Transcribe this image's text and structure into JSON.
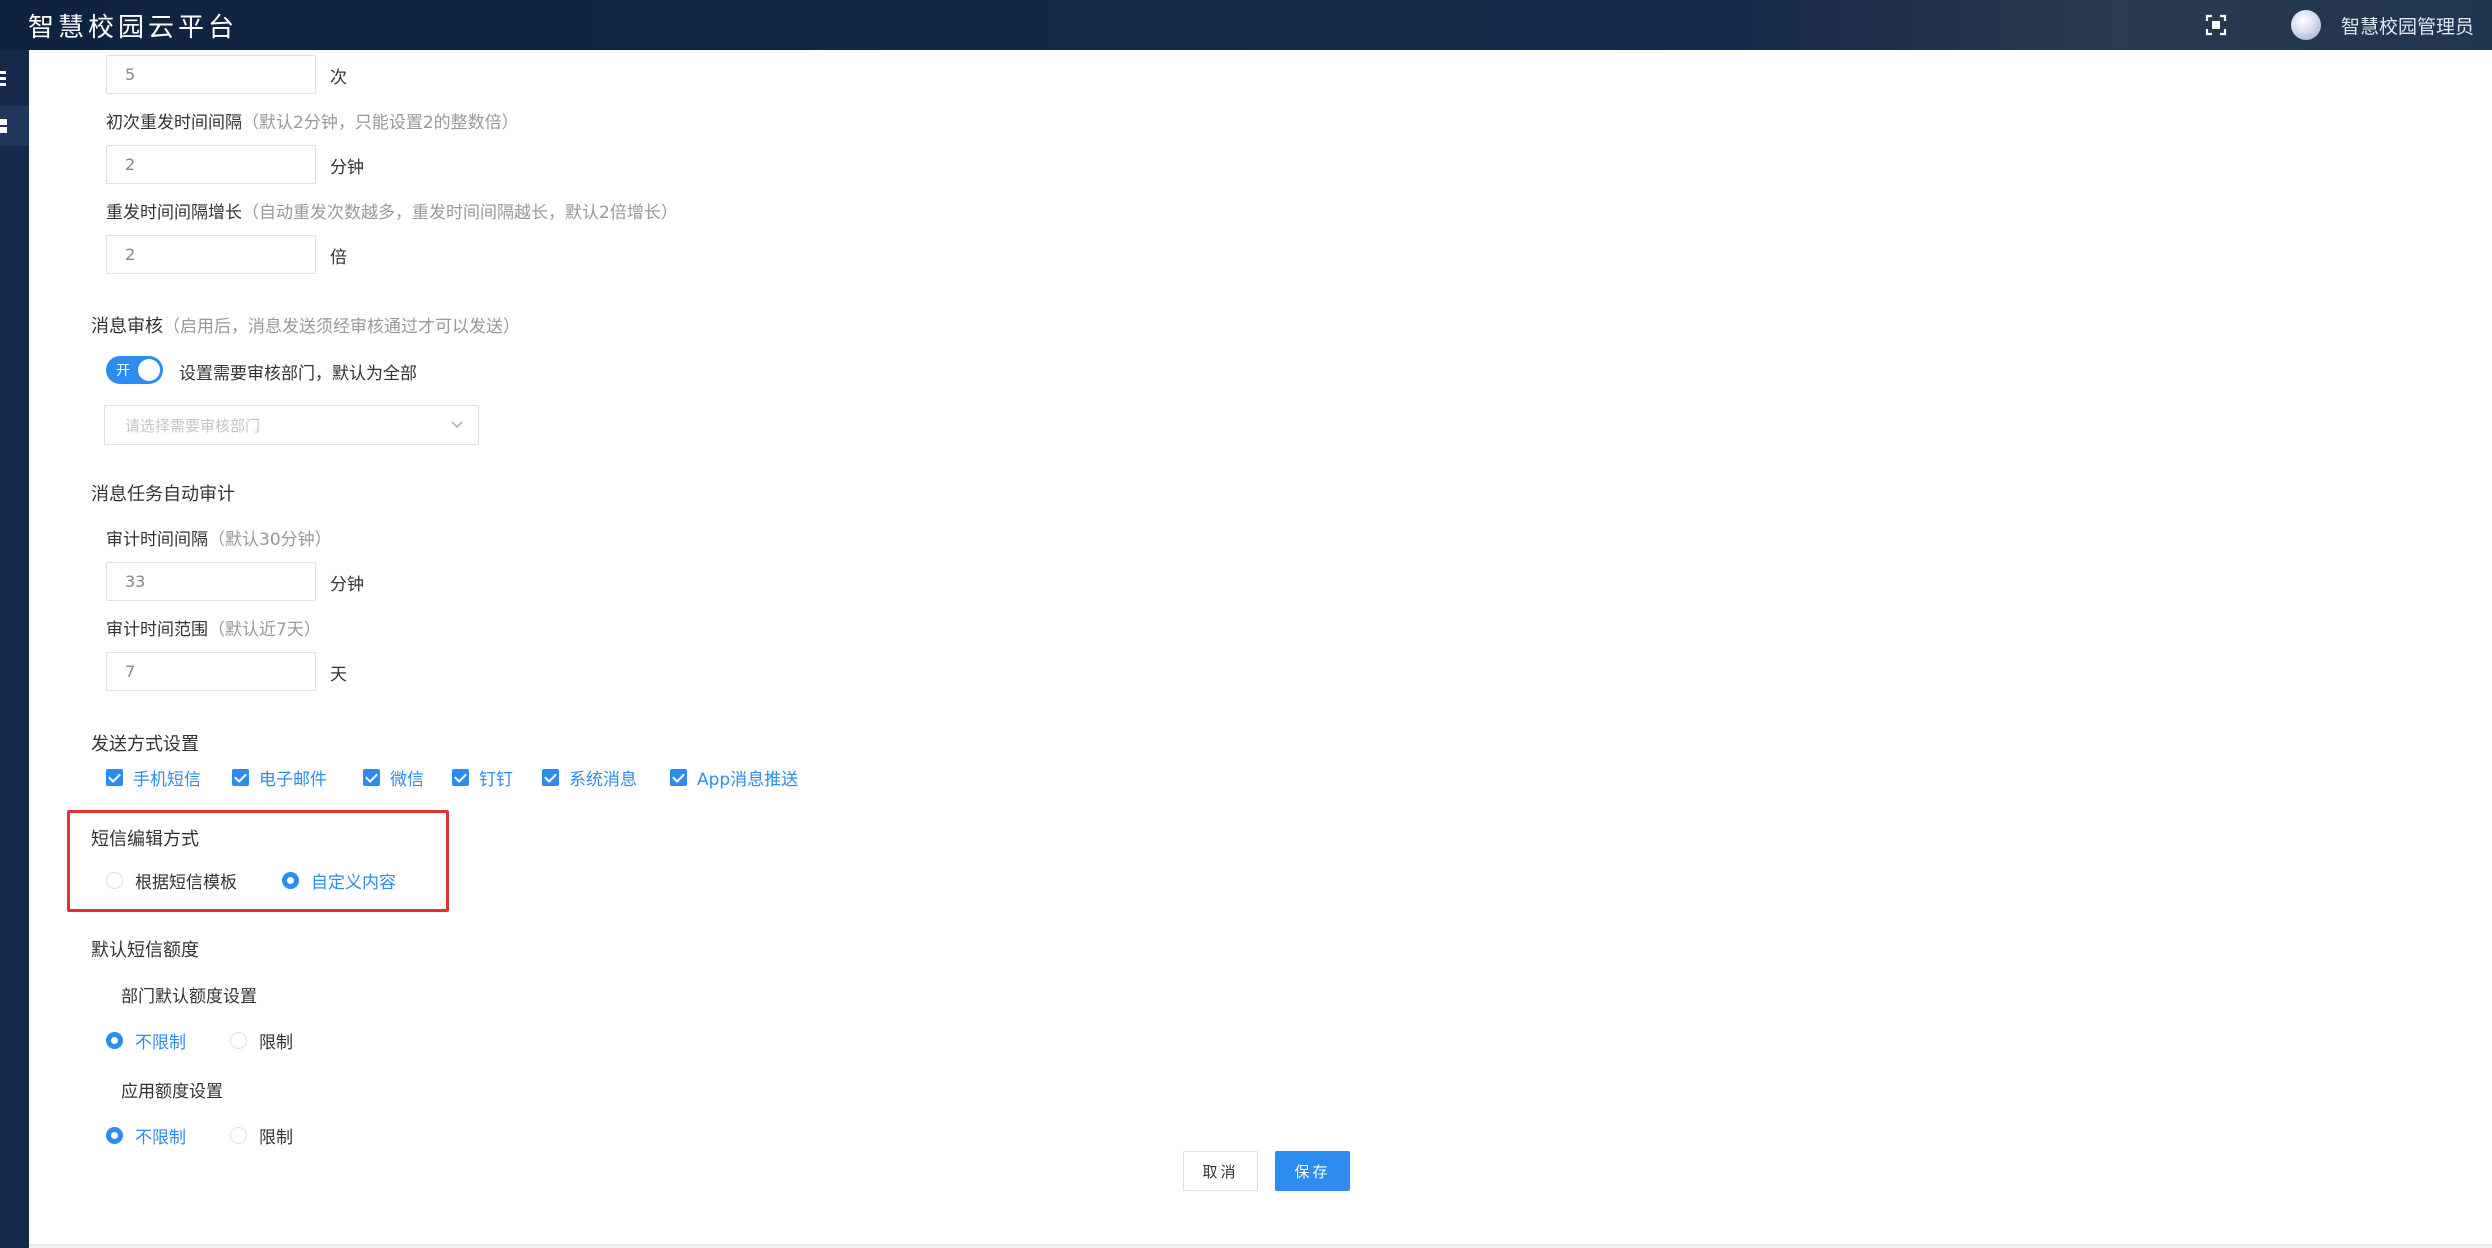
{
  "header": {
    "title": "智慧校园云平台",
    "username": "智慧校园管理员",
    "icons": {
      "fullscreen": "fullscreen-icon",
      "avatar": "avatar"
    }
  },
  "sidebar": {
    "icons": [
      "menu-icon",
      "grid-icon"
    ]
  },
  "retry": {
    "count_value": "5",
    "count_unit": "次",
    "first_interval_label": "初次重发时间间隔",
    "first_interval_hint": "（默认2分钟，只能设置2的整数倍）",
    "first_interval_value": "2",
    "first_interval_unit": "分钟",
    "growth_label": "重发时间间隔增长",
    "growth_hint": "（自动重发次数越多，重发时间间隔越长，默认2倍增长）",
    "growth_value": "2",
    "growth_unit": "倍"
  },
  "review": {
    "title": "消息审核",
    "hint": "（启用后，消息发送须经审核通过才可以发送）",
    "toggle_text": "开",
    "toggle_on": true,
    "toggle_desc": "设置需要审核部门，默认为全部",
    "select_placeholder": "请选择需要审核部门"
  },
  "audit": {
    "title": "消息任务自动审计",
    "interval_label": "审计时间间隔",
    "interval_hint": "（默认30分钟）",
    "interval_value": "33",
    "interval_unit": "分钟",
    "range_label": "审计时间范围",
    "range_hint": "（默认近7天）",
    "range_value": "7",
    "range_unit": "天"
  },
  "send_methods": {
    "title": "发送方式设置",
    "items": [
      {
        "label": "手机短信",
        "checked": true
      },
      {
        "label": "电子邮件",
        "checked": true
      },
      {
        "label": "微信",
        "checked": true
      },
      {
        "label": "钉钉",
        "checked": true
      },
      {
        "label": "系统消息",
        "checked": true
      },
      {
        "label": "App消息推送",
        "checked": true
      }
    ]
  },
  "sms_edit": {
    "title": "短信编辑方式",
    "options": [
      {
        "label": "根据短信模板",
        "selected": false
      },
      {
        "label": "自定义内容",
        "selected": true
      }
    ],
    "highlight_color": "#e03434"
  },
  "quota": {
    "title": "默认短信额度",
    "dept_label": "部门默认额度设置",
    "dept_options": [
      {
        "label": "不限制",
        "selected": true
      },
      {
        "label": "限制",
        "selected": false
      }
    ],
    "app_label": "应用额度设置",
    "app_options": [
      {
        "label": "不限制",
        "selected": true
      },
      {
        "label": "限制",
        "selected": false
      }
    ]
  },
  "actions": {
    "cancel_label": "取消",
    "save_label": "保存"
  },
  "colors": {
    "accent": "#2d8cf0",
    "header_bg": "#16294a"
  }
}
